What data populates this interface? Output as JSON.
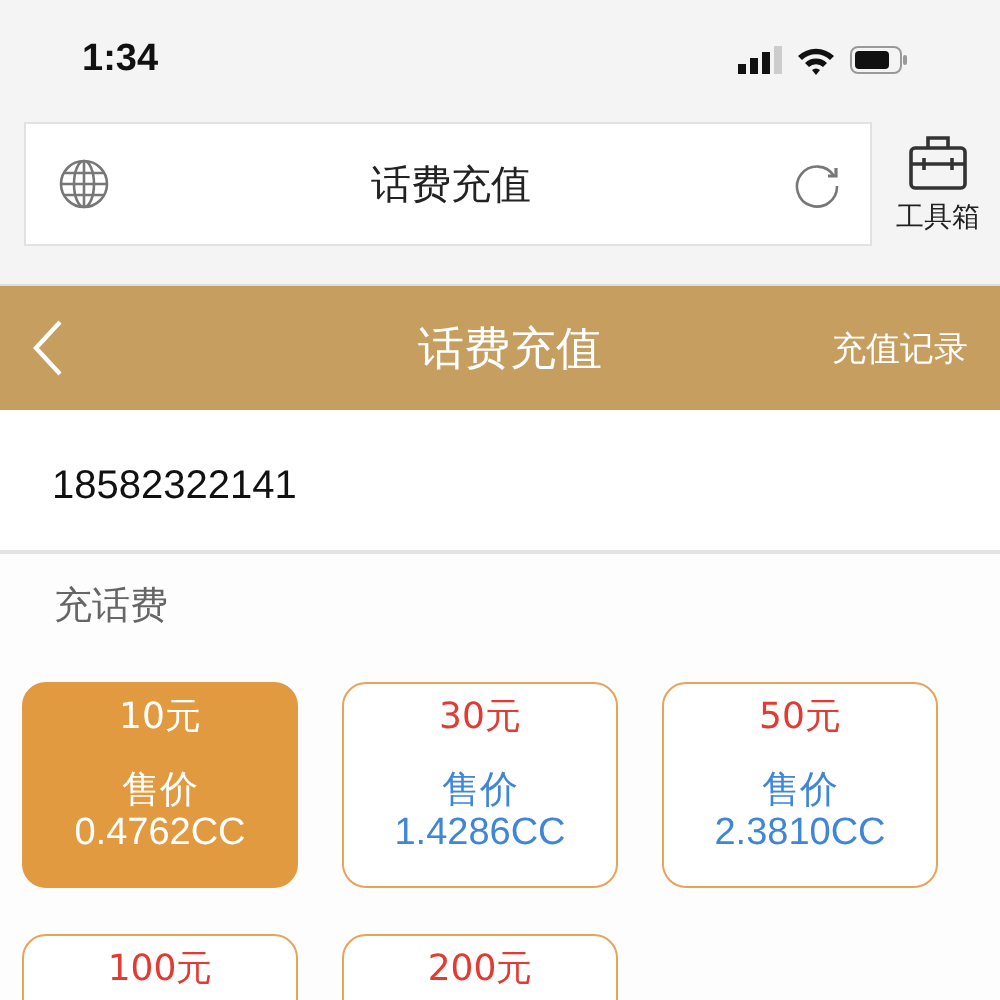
{
  "status_bar": {
    "time": "1:34"
  },
  "browser_bar": {
    "address": "话费充值",
    "toolbox_label": "工具箱"
  },
  "header": {
    "title": "话费充值",
    "action": "充值记录"
  },
  "phone": {
    "value": "18582322141"
  },
  "section_label": "充话费",
  "options": [
    {
      "amount": "10元",
      "price_label": "售价",
      "price": "0.4762CC",
      "selected": true
    },
    {
      "amount": "30元",
      "price_label": "售价",
      "price": "1.4286CC",
      "selected": false
    },
    {
      "amount": "50元",
      "price_label": "售价",
      "price": "2.3810CC",
      "selected": false
    },
    {
      "amount": "100元",
      "selected": false
    },
    {
      "amount": "200元",
      "selected": false
    }
  ]
}
